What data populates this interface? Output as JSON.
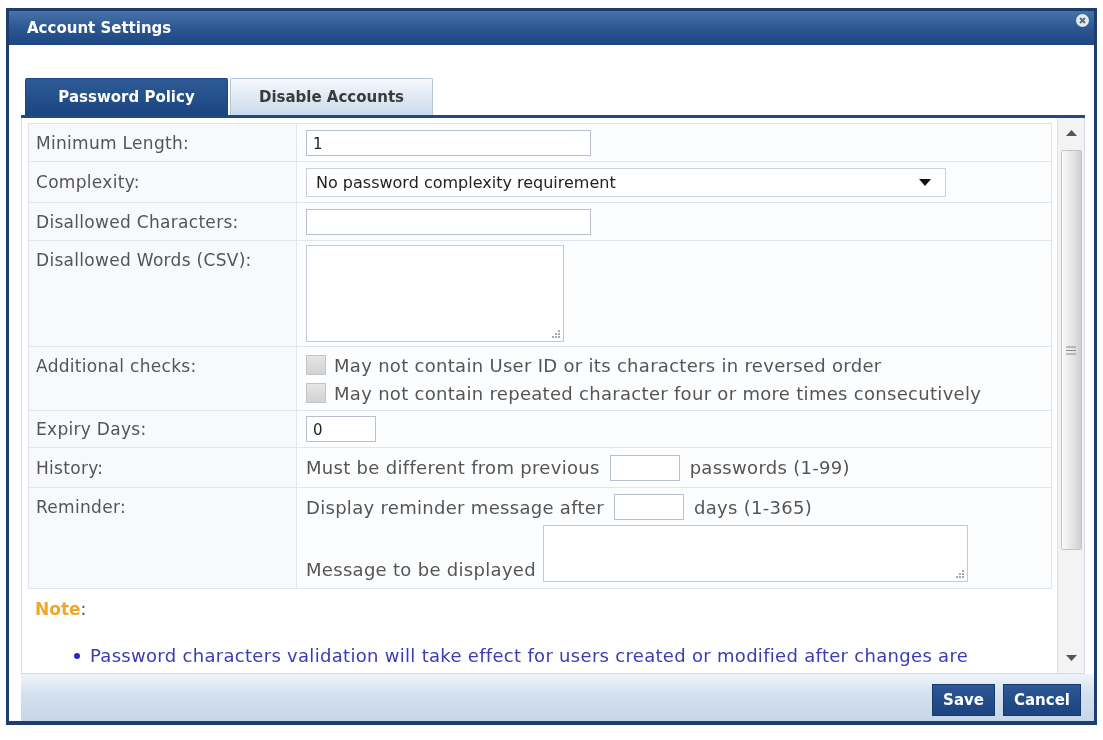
{
  "window": {
    "title": "Account Settings"
  },
  "tabs": [
    {
      "label": "Password Policy",
      "selected": true
    },
    {
      "label": "Disable Accounts",
      "selected": false
    }
  ],
  "form": {
    "rows": [
      {
        "kind": "text",
        "label": "Minimum Length:",
        "value": "1"
      },
      {
        "kind": "select",
        "label": "Complexity:",
        "value": "No password complexity requirement"
      },
      {
        "kind": "text",
        "label": "Disallowed Characters:"
      },
      {
        "kind": "textarea",
        "label": "Disallowed Words (CSV):"
      },
      {
        "kind": "checks",
        "label": "Additional checks:",
        "options": [
          {
            "label": "May not contain User ID or its characters in reversed order",
            "checked": false
          },
          {
            "label": "May not contain repeated character four or more times consecutively",
            "checked": false
          }
        ]
      },
      {
        "kind": "short",
        "label": "Expiry Days:",
        "value": "0"
      },
      {
        "kind": "inline",
        "label": "History:",
        "before": "Must be different from previous",
        "after": "passwords (1-99)"
      },
      {
        "kind": "reminder",
        "label": "Reminder:",
        "before": "Display reminder message after",
        "after": "days (1-365)",
        "message_label": "Message to be displayed"
      }
    ]
  },
  "note": {
    "label": "Note",
    "punctuation": ":",
    "items": [
      "Password characters validation will take effect for users created or modified after changes are"
    ]
  },
  "buttons": [
    {
      "label": "Save"
    },
    {
      "label": "Cancel"
    }
  ]
}
